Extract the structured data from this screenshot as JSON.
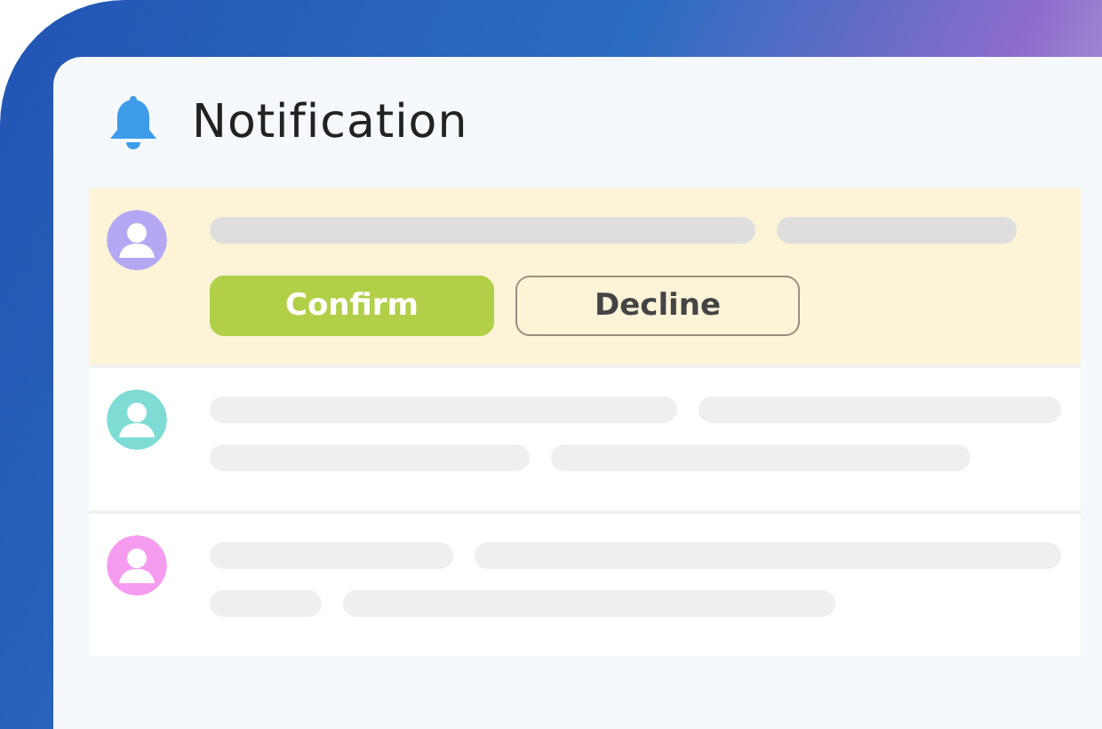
{
  "panel": {
    "title": "Notification"
  },
  "notifications": [
    {
      "kind": "request",
      "highlighted": true,
      "color": "#b4a8f5",
      "actions": [
        {
          "label": "Confirm",
          "kind": "primary"
        },
        {
          "label": "Decline",
          "kind": "secondary"
        }
      ]
    },
    {
      "kind": "plain",
      "highlighted": false,
      "color": "#7fdcd5"
    },
    {
      "kind": "plain",
      "highlighted": false,
      "color": "#f59cf0"
    }
  ]
}
